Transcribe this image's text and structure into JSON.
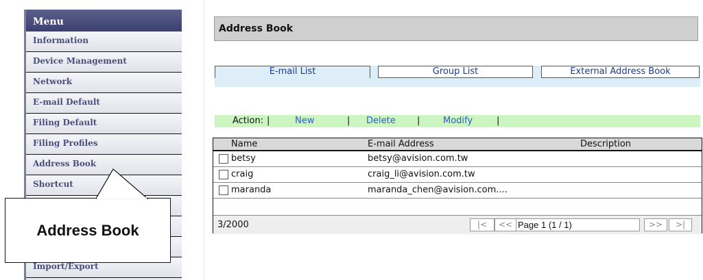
{
  "sidebar": {
    "header": "Menu",
    "items": [
      {
        "label": "Information"
      },
      {
        "label": "Device Management"
      },
      {
        "label": "Network"
      },
      {
        "label": "E-mail Default"
      },
      {
        "label": "Filing Default"
      },
      {
        "label": "Filing Profiles"
      },
      {
        "label": "Address Book"
      },
      {
        "label": "Shortcut"
      },
      {
        "label": ""
      },
      {
        "label": ""
      },
      {
        "label": ""
      },
      {
        "label": "Import/Export"
      }
    ]
  },
  "callout": {
    "label": "Address Book"
  },
  "main": {
    "title": "Address Book",
    "tabs": [
      {
        "label": "E-mail List"
      },
      {
        "label": "Group List"
      },
      {
        "label": "External Address Book"
      }
    ],
    "action_bar": {
      "label": "Action:",
      "separator": "|",
      "new": "New",
      "delete": "Delete",
      "modify": "Modify"
    },
    "table": {
      "columns": [
        "Name",
        "E-mail Address",
        "Description"
      ],
      "rows": [
        {
          "name": "betsy",
          "email": "betsy@avision.com.tw",
          "description": ""
        },
        {
          "name": "craig",
          "email": "craig_li@avision.com.tw",
          "description": ""
        },
        {
          "name": "maranda",
          "email": "maranda_chen@avision.com....",
          "description": ""
        }
      ],
      "footer": {
        "count": "3/2000",
        "first": "|<",
        "prev": "<<",
        "page": "Page 1 (1 / 1)",
        "next": ">>",
        "last": ">|"
      }
    }
  }
}
